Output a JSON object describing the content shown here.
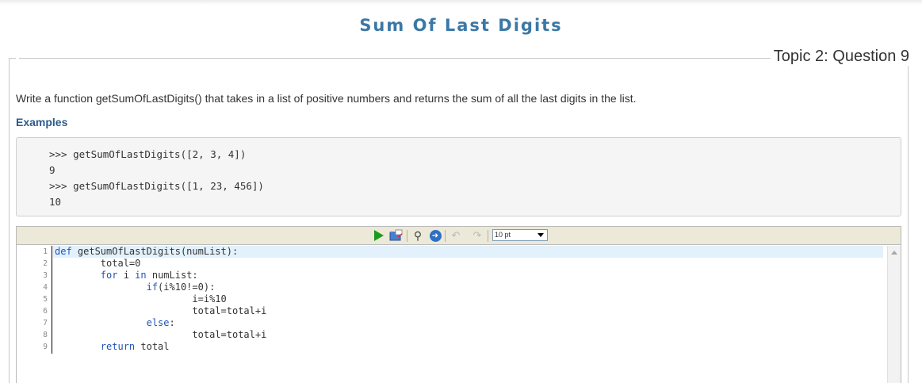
{
  "page": {
    "title": "Sum Of Last Digits",
    "topic_label": "Topic 2: Question 9"
  },
  "question": {
    "description": "Write a function getSumOfLastDigits() that takes in a list of positive numbers and returns the sum of all the last digits in the list.",
    "examples_heading": "Examples",
    "examples": [
      ">>> getSumOfLastDigits([2, 3, 4])",
      "9",
      ">>> getSumOfLastDigits([1, 23, 456])",
      "10"
    ]
  },
  "editor": {
    "toolbar": {
      "run_icon": "play-icon",
      "open_icon": "open-folder-icon",
      "search_icon": "binoculars-icon",
      "goto_icon": "goto-line-icon",
      "undo_icon": "undo-icon",
      "redo_icon": "redo-icon",
      "font_size": "10 pt"
    },
    "line_numbers": [
      "1",
      "2",
      "3",
      "4",
      "5",
      "6",
      "7",
      "8",
      "9"
    ],
    "code_lines": [
      "def getSumOfLastDigits(numList):",
      "        total=0",
      "        for i in numList:",
      "                if(i%10!=0):",
      "                        i=i%10",
      "                        total=total+i",
      "                else:",
      "                        total=total+i",
      "        return total"
    ]
  },
  "colors": {
    "title": "#3a78a6",
    "heading": "#2b5c8a",
    "keyword": "#2154b8",
    "active_line": "#e2f1fb",
    "toolbar_bg": "#ece9d8"
  }
}
